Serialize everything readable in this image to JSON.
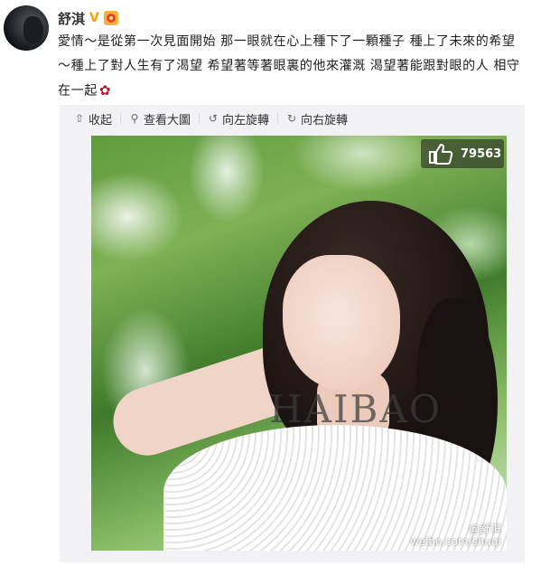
{
  "user": {
    "name": "舒淇",
    "verified_mark": "V"
  },
  "post": {
    "text": "愛情～是從第一次見面開始 那一眼就在心上種下了一顆種子 種上了未來的希望 ～種上了對人生有了渴望 希望著等著眼裏的他來灌溉 渴望著能跟對眼的人 相守在一起",
    "emoji": "rose-icon"
  },
  "toolbar": {
    "collect_label": "收起",
    "view_large_label": "查看大圖",
    "rotate_left_label": "向左旋轉",
    "rotate_right_label": "向右旋轉"
  },
  "photo": {
    "like_count": "79563",
    "watermark": "HAIBAO",
    "credit_line1": "@舒淇",
    "credit_line2": "weibo.com/shuqi"
  },
  "colors": {
    "verified": "#f5a200",
    "card_bg": "#f2f2f5",
    "rose": "#c8102e"
  }
}
